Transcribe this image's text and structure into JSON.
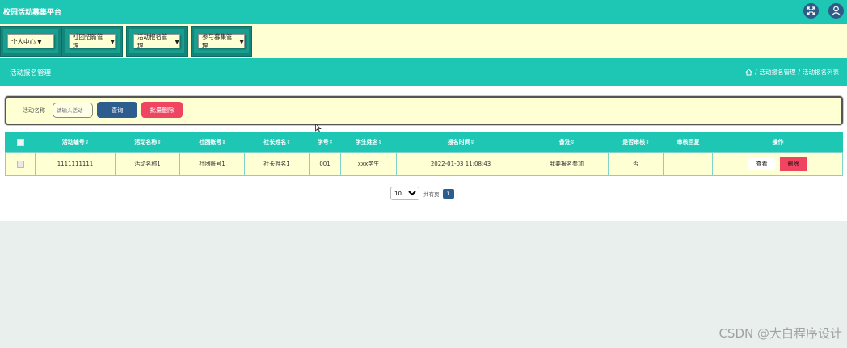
{
  "app": {
    "title": "校园活动募集平台"
  },
  "header": {
    "icons": [
      "fullscreen-icon",
      "user-icon"
    ]
  },
  "nav": {
    "items": [
      {
        "label": "个人中心"
      },
      {
        "label": "社团招新管理"
      },
      {
        "label": "活动报名管理"
      },
      {
        "label": "参与募集管理"
      }
    ]
  },
  "section": {
    "title": "活动报名管理",
    "breadcrumb": [
      "活动报名管理",
      "活动报名列表"
    ],
    "breadcrumb_sep": "/"
  },
  "search": {
    "label": "活动名称",
    "placeholder": "请输入活动",
    "query_label": "查询",
    "batch_delete_label": "批量删除"
  },
  "table": {
    "columns": [
      "活动编号",
      "活动名称",
      "社团账号",
      "社长姓名",
      "学号",
      "学生姓名",
      "报名时间",
      "备注",
      "是否审核",
      "审核回复",
      "操作"
    ],
    "sortable": [
      true,
      true,
      true,
      true,
      true,
      true,
      true,
      true,
      true,
      false,
      false
    ],
    "sort_mark": "⇕",
    "rows": [
      {
        "id": "1111111111",
        "name": "活动名称1",
        "club_account": "社团账号1",
        "president": "社长姓名1",
        "student_no": "001",
        "student_name": "xxx学生",
        "time": "2022-01-03 11:08:43",
        "remark": "我要报名参加",
        "reviewed": "否",
        "reply": ""
      }
    ],
    "actions": {
      "view": "查看",
      "delete": "删除"
    }
  },
  "pagination": {
    "page_size": "10",
    "page_size_options": [
      "10"
    ],
    "total_text": "共有页",
    "current_page": "1"
  },
  "watermark": "CSDN @大白程序设计",
  "colors": {
    "teal": "#1ec6b4",
    "cream": "#ffffd4",
    "navy": "#2d5c8f",
    "red": "#ef4560"
  }
}
